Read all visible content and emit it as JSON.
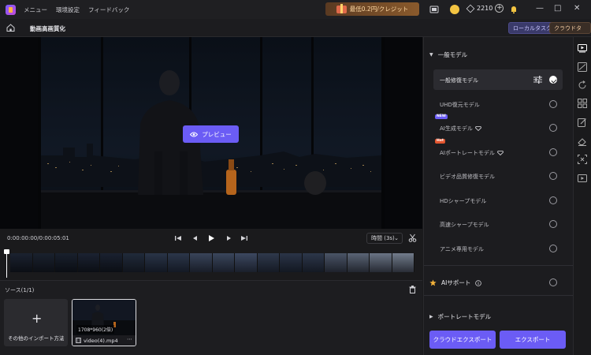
{
  "titlebar": {
    "menu": [
      "メニュー",
      "環境設定",
      "フィードバック"
    ],
    "promo": "最低0.2円/クレジット",
    "credits": "2210"
  },
  "subbar": {
    "title": "動画高画質化",
    "local_task": "ローカルタスク",
    "cloud_task": "クラウドタスク"
  },
  "preview": {
    "button_label": "プレビュー"
  },
  "playback": {
    "timecode": "0:00:00:00/0:00:05:01",
    "speed": "時間 (3s)"
  },
  "source": {
    "title": "ソース(1/1)",
    "import_label": "その他のインポート方法",
    "video": {
      "resolution": "1708*960(2倍)",
      "filename": "video(4).mp4"
    }
  },
  "right_panel": {
    "general_section": "一般モデル",
    "models": [
      {
        "label": "一般修復モデル",
        "selected": true,
        "badge": ""
      },
      {
        "label": "UHD復元モデル",
        "selected": false,
        "badge": ""
      },
      {
        "label": "AI生成モデル",
        "selected": false,
        "badge": "NEW"
      },
      {
        "label": "AIポートレートモデル",
        "selected": false,
        "badge": "Hot"
      },
      {
        "label": "ビデオ品質修復モデル",
        "selected": false,
        "badge": ""
      },
      {
        "label": "HDシャープモデル",
        "selected": false,
        "badge": ""
      },
      {
        "label": "高速シャープモデル",
        "selected": false,
        "badge": ""
      },
      {
        "label": "アニメ専用モデル",
        "selected": false,
        "badge": ""
      }
    ],
    "ai_support": "AIサポート",
    "portrait_section": "ポートレートモデル",
    "cloud_export": "クラウドエクスポート",
    "export": "エクスポート"
  },
  "colors": {
    "accent": "#6b5cf5",
    "background": "#1a1a1c",
    "panel": "#1c1c1f"
  }
}
